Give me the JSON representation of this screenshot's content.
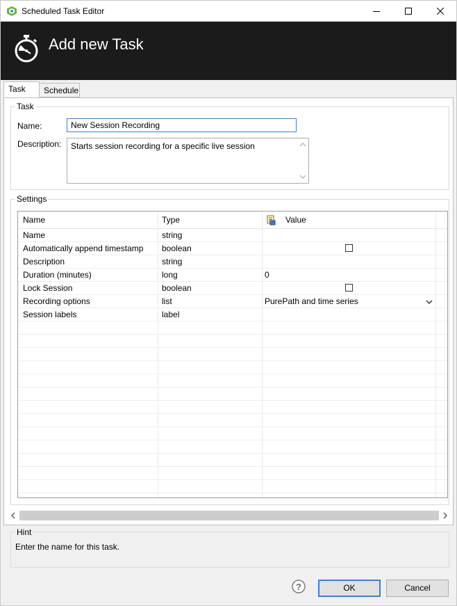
{
  "window": {
    "title": "Scheduled Task Editor"
  },
  "banner": {
    "title": "Add new Task",
    "icon": "stopwatch-icon"
  },
  "tabs": [
    {
      "label": "Task",
      "active": true
    },
    {
      "label": "Schedule",
      "active": false
    }
  ],
  "task_group": {
    "label": "Task",
    "name_label": "Name:",
    "name_value": "New Session Recording",
    "description_label": "Description:",
    "description_value": "Starts session recording for a specific live session"
  },
  "settings": {
    "label": "Settings",
    "columns": [
      "Name",
      "Type",
      "Value"
    ],
    "rows": [
      {
        "name": "Name",
        "type": "string",
        "value": ""
      },
      {
        "name": "Automatically append timestamp",
        "type": "boolean",
        "value": "",
        "checkbox": true,
        "checked": false
      },
      {
        "name": "Description",
        "type": "string",
        "value": ""
      },
      {
        "name": "Duration (minutes)",
        "type": "long",
        "value": "0"
      },
      {
        "name": "Lock Session",
        "type": "boolean",
        "value": "",
        "checkbox": true,
        "checked": false
      },
      {
        "name": "Recording options",
        "type": "list",
        "value": "PurePath and time series",
        "dropdown": true
      },
      {
        "name": "Session labels",
        "type": "label",
        "value": ""
      }
    ]
  },
  "hint": {
    "label": "Hint",
    "text": "Enter the name for this task."
  },
  "buttons": {
    "ok": "OK",
    "cancel": "Cancel"
  },
  "colors": {
    "banner": "#1b1b1b",
    "accent": "#3c7fd7"
  }
}
